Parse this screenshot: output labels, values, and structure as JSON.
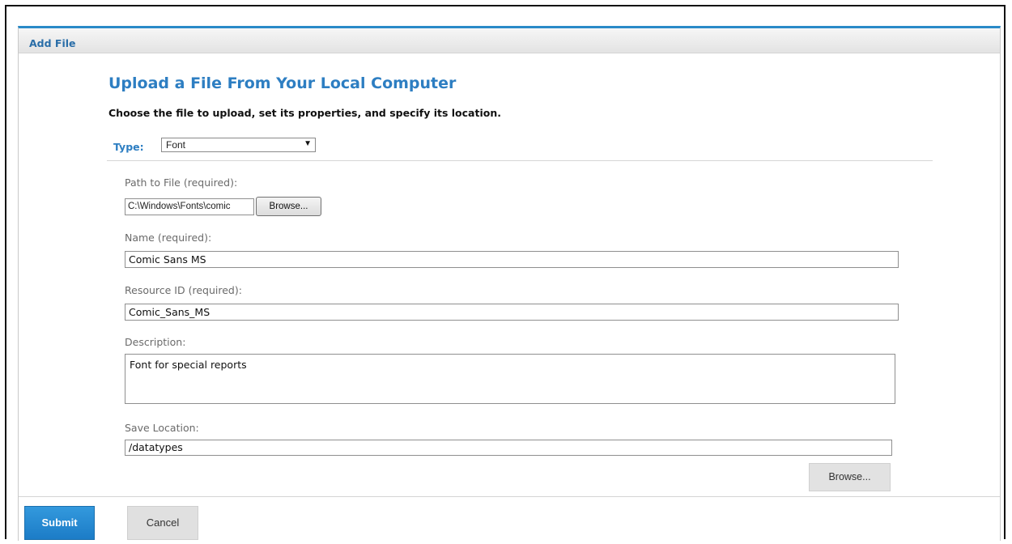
{
  "dialog": {
    "title": "Add File",
    "heading": "Upload a File From Your Local Computer",
    "subheading": "Choose the file to upload, set its properties, and specify its location."
  },
  "type_field": {
    "label": "Type:",
    "selected": "Font"
  },
  "path_field": {
    "label": "Path to File (required):",
    "value": "C:\\Windows\\Fonts\\comic",
    "browse_label": "Browse..."
  },
  "name_field": {
    "label": "Name (required):",
    "value": "Comic Sans MS"
  },
  "resource_id_field": {
    "label": "Resource ID (required):",
    "value": "Comic_Sans_MS"
  },
  "description_field": {
    "label": "Description:",
    "value": "Font for special reports"
  },
  "save_location_field": {
    "label": "Save Location:",
    "value": "/datatypes",
    "browse_label": "Browse..."
  },
  "footer": {
    "submit_label": "Submit",
    "cancel_label": "Cancel"
  },
  "colors": {
    "accent": "#2d7ec2",
    "submit_bg": "#2a8ad2",
    "neutral_button": "#e0e0e0"
  }
}
